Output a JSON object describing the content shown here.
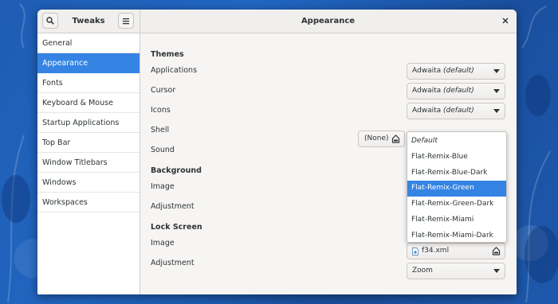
{
  "window": {
    "app_title": "Tweaks",
    "page_title": "Appearance"
  },
  "sidebar": {
    "items": [
      {
        "label": "General"
      },
      {
        "label": "Appearance"
      },
      {
        "label": "Fonts"
      },
      {
        "label": "Keyboard & Mouse"
      },
      {
        "label": "Startup Applications"
      },
      {
        "label": "Top Bar"
      },
      {
        "label": "Window Titlebars"
      },
      {
        "label": "Windows"
      },
      {
        "label": "Workspaces"
      }
    ],
    "selected": "Appearance"
  },
  "themes": {
    "heading": "Themes",
    "applications": {
      "label": "Applications",
      "value": "Adwaita",
      "suffix": "(default)"
    },
    "cursor": {
      "label": "Cursor",
      "value": "Adwaita",
      "suffix": "(default)"
    },
    "icons": {
      "label": "Icons",
      "value": "Adwaita",
      "suffix": "(default)"
    },
    "shell": {
      "label": "Shell",
      "file_value": "(None)"
    },
    "sound": {
      "label": "Sound"
    }
  },
  "background": {
    "heading": "Background",
    "image": {
      "label": "Image"
    },
    "adjustment": {
      "label": "Adjustment"
    }
  },
  "lock_screen": {
    "heading": "Lock Screen",
    "image": {
      "label": "Image",
      "value": "f34.xml"
    },
    "adjustment": {
      "label": "Adjustment",
      "value": "Zoom"
    }
  },
  "dropdown": {
    "options": [
      "Default",
      "Flat-Remix-Blue",
      "Flat-Remix-Blue-Dark",
      "Flat-Remix-Green",
      "Flat-Remix-Green-Dark",
      "Flat-Remix-Miami",
      "Flat-Remix-Miami-Dark"
    ],
    "selected": "Flat-Remix-Green"
  },
  "colors": {
    "accent": "#3584e4",
    "window_bg": "#f6f5f4",
    "wallpaper": "#1c56a8"
  },
  "icons": {
    "search": "search-icon",
    "menu": "hamburger-menu-icon",
    "close": "close-icon",
    "document": "document-icon",
    "xml_file": "xml-file-icon"
  }
}
